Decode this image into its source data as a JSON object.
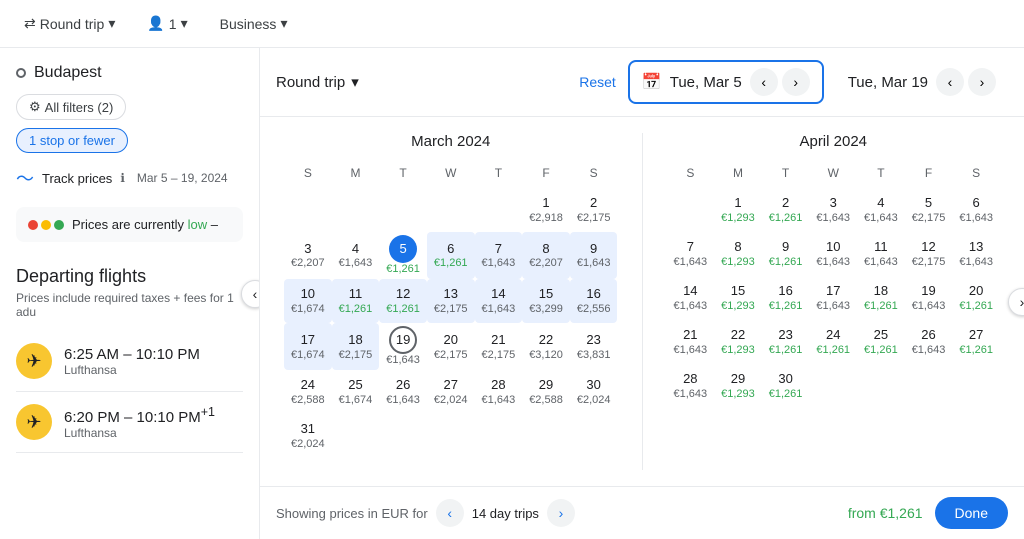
{
  "topBar": {
    "tripType": "Round trip",
    "passengers": "1",
    "cabinClass": "Business",
    "dropdownArrow": "▾"
  },
  "sidebar": {
    "searchCity": "Budapest",
    "filters": {
      "allFilters": "All filters (2)",
      "stops": "1 stop or fewer"
    },
    "trackPrices": {
      "label": "Track prices",
      "infoIcon": "ℹ",
      "dateRange": "Mar 5 – 19, 2024"
    },
    "priceBanner": {
      "text": "Prices are currently low –",
      "lowText": "low"
    },
    "departing": {
      "title": "Departing flights",
      "subtitle": "Prices include required taxes + fees for 1 adu",
      "flights": [
        {
          "time": "6:25 AM – 10:10 PM",
          "airline": "Lufthansa"
        },
        {
          "time": "6:20 PM – 10:10 PM+1",
          "airline": "Lufthansa"
        }
      ]
    }
  },
  "calendar": {
    "tripType": "Round trip",
    "resetLabel": "Reset",
    "selectedStart": "Tue, Mar 5",
    "selectedEnd": "Tue, Mar 19",
    "march": {
      "title": "March 2024",
      "dayHeaders": [
        "S",
        "M",
        "T",
        "W",
        "T",
        "F",
        "S"
      ],
      "weeks": [
        [
          {
            "num": "",
            "price": "",
            "type": "empty"
          },
          {
            "num": "",
            "price": "",
            "type": "empty"
          },
          {
            "num": "",
            "price": "",
            "type": "empty"
          },
          {
            "num": "",
            "price": "",
            "type": "empty"
          },
          {
            "num": "",
            "price": "",
            "type": "empty"
          },
          {
            "num": "1",
            "price": "€2,918",
            "type": "normal"
          },
          {
            "num": "2",
            "price": "€2,175",
            "type": "normal"
          }
        ],
        [
          {
            "num": "3",
            "price": "€2,207",
            "type": "normal"
          },
          {
            "num": "4",
            "price": "€1,643",
            "type": "normal"
          },
          {
            "num": "5",
            "price": "€1,261",
            "type": "low",
            "selected": "start"
          },
          {
            "num": "6",
            "price": "€1,261",
            "type": "low",
            "inRange": true
          },
          {
            "num": "7",
            "price": "€1,643",
            "type": "normal",
            "inRange": true
          },
          {
            "num": "8",
            "price": "€2,207",
            "type": "normal",
            "inRange": true
          },
          {
            "num": "9",
            "price": "€1,643",
            "type": "normal",
            "inRange": true
          }
        ],
        [
          {
            "num": "10",
            "price": "€1,674",
            "type": "normal",
            "inRange": true
          },
          {
            "num": "11",
            "price": "€1,261",
            "type": "low",
            "inRange": true
          },
          {
            "num": "12",
            "price": "€1,261",
            "type": "low",
            "inRange": true
          },
          {
            "num": "13",
            "price": "€2,175",
            "type": "normal",
            "inRange": true
          },
          {
            "num": "14",
            "price": "€1,643",
            "type": "normal",
            "inRange": true
          },
          {
            "num": "15",
            "price": "€3,299",
            "type": "normal",
            "inRange": true
          },
          {
            "num": "16",
            "price": "€2,556",
            "type": "normal",
            "inRange": true
          }
        ],
        [
          {
            "num": "17",
            "price": "€1,674",
            "type": "normal",
            "inRange": true
          },
          {
            "num": "18",
            "price": "€2,175",
            "type": "normal",
            "inRange": true
          },
          {
            "num": "19",
            "price": "€1,643",
            "type": "normal",
            "selected": "end"
          },
          {
            "num": "20",
            "price": "€2,175",
            "type": "normal"
          },
          {
            "num": "21",
            "price": "€2,175",
            "type": "normal"
          },
          {
            "num": "22",
            "price": "€3,120",
            "type": "normal"
          },
          {
            "num": "23",
            "price": "€3,831",
            "type": "normal"
          }
        ],
        [
          {
            "num": "24",
            "price": "€2,588",
            "type": "normal"
          },
          {
            "num": "25",
            "price": "€1,674",
            "type": "normal"
          },
          {
            "num": "26",
            "price": "€1,643",
            "type": "normal"
          },
          {
            "num": "27",
            "price": "€2,024",
            "type": "normal"
          },
          {
            "num": "28",
            "price": "€1,643",
            "type": "normal"
          },
          {
            "num": "29",
            "price": "€2,588",
            "type": "normal"
          },
          {
            "num": "30",
            "price": "€2,024",
            "type": "normal"
          }
        ],
        [
          {
            "num": "31",
            "price": "€2,024",
            "type": "normal"
          },
          {
            "num": "",
            "price": "",
            "type": "empty"
          },
          {
            "num": "",
            "price": "",
            "type": "empty"
          },
          {
            "num": "",
            "price": "",
            "type": "empty"
          },
          {
            "num": "",
            "price": "",
            "type": "empty"
          },
          {
            "num": "",
            "price": "",
            "type": "empty"
          },
          {
            "num": "",
            "price": "",
            "type": "empty"
          }
        ]
      ]
    },
    "april": {
      "title": "April 2024",
      "dayHeaders": [
        "S",
        "M",
        "T",
        "W",
        "T",
        "F",
        "S"
      ],
      "weeks": [
        [
          {
            "num": "",
            "price": "",
            "type": "empty"
          },
          {
            "num": "1",
            "price": "€1,293",
            "type": "low"
          },
          {
            "num": "2",
            "price": "€1,261",
            "type": "low"
          },
          {
            "num": "3",
            "price": "€1,643",
            "type": "normal"
          },
          {
            "num": "4",
            "price": "€1,643",
            "type": "normal"
          },
          {
            "num": "5",
            "price": "€2,175",
            "type": "normal"
          },
          {
            "num": "6",
            "price": "€1,643",
            "type": "normal"
          }
        ],
        [
          {
            "num": "7",
            "price": "€1,643",
            "type": "normal"
          },
          {
            "num": "8",
            "price": "€1,293",
            "type": "low"
          },
          {
            "num": "9",
            "price": "€1,261",
            "type": "low"
          },
          {
            "num": "10",
            "price": "€1,643",
            "type": "normal"
          },
          {
            "num": "11",
            "price": "€1,643",
            "type": "normal"
          },
          {
            "num": "12",
            "price": "€2,175",
            "type": "normal"
          },
          {
            "num": "13",
            "price": "€1,643",
            "type": "normal"
          }
        ],
        [
          {
            "num": "14",
            "price": "€1,643",
            "type": "normal"
          },
          {
            "num": "15",
            "price": "€1,293",
            "type": "low"
          },
          {
            "num": "16",
            "price": "€1,261",
            "type": "low"
          },
          {
            "num": "17",
            "price": "€1,643",
            "type": "normal"
          },
          {
            "num": "18",
            "price": "€1,261",
            "type": "low"
          },
          {
            "num": "19",
            "price": "€1,643",
            "type": "normal"
          },
          {
            "num": "20",
            "price": "€1,261",
            "type": "low"
          }
        ],
        [
          {
            "num": "21",
            "price": "€1,643",
            "type": "normal"
          },
          {
            "num": "22",
            "price": "€1,293",
            "type": "low"
          },
          {
            "num": "23",
            "price": "€1,261",
            "type": "low"
          },
          {
            "num": "24",
            "price": "€1,261",
            "type": "low"
          },
          {
            "num": "25",
            "price": "€1,261",
            "type": "low"
          },
          {
            "num": "26",
            "price": "€1,643",
            "type": "normal"
          },
          {
            "num": "27",
            "price": "€1,261",
            "type": "low"
          }
        ],
        [
          {
            "num": "28",
            "price": "€1,643",
            "type": "normal"
          },
          {
            "num": "29",
            "price": "€1,293",
            "type": "low"
          },
          {
            "num": "30",
            "price": "€1,261",
            "type": "low"
          },
          {
            "num": "",
            "price": "",
            "type": "empty"
          },
          {
            "num": "",
            "price": "",
            "type": "empty"
          },
          {
            "num": "",
            "price": "",
            "type": "empty"
          },
          {
            "num": "",
            "price": "",
            "type": "empty"
          }
        ]
      ]
    },
    "footer": {
      "showingText": "Showing prices in EUR for",
      "tripLength": "14 day trips",
      "fromPrice": "from €1,261",
      "doneLabel": "Done"
    }
  }
}
